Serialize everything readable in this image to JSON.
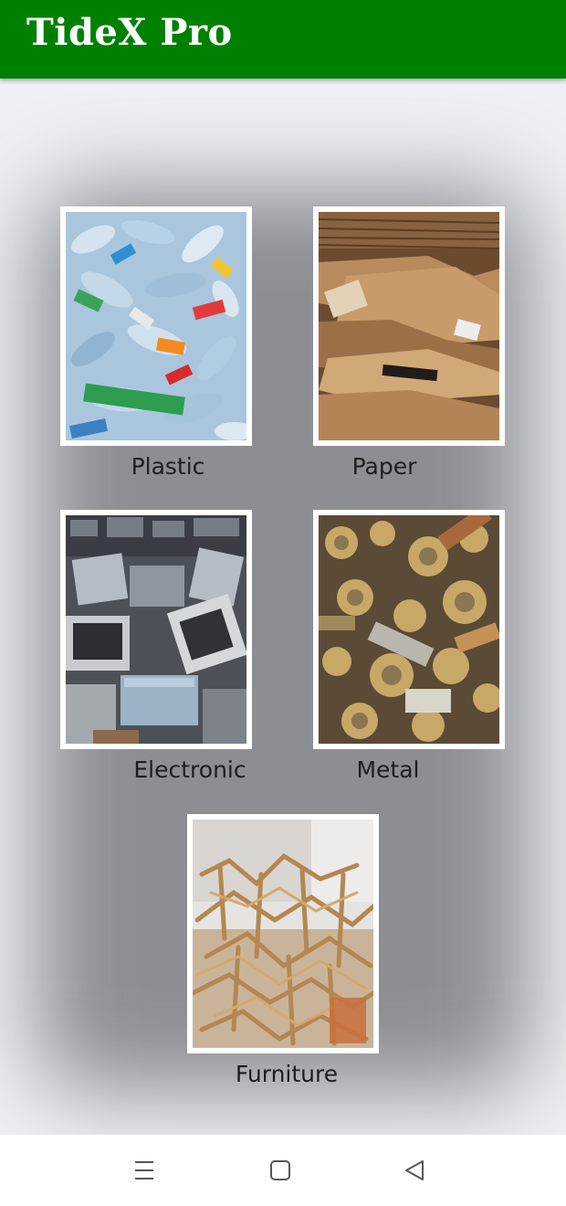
{
  "app": {
    "title": "TideX Pro",
    "colors": {
      "app_bar": "#008000",
      "background": "#eef0f5",
      "nav_bar": "#ffffff",
      "label_text": "#1e1e1e"
    }
  },
  "categories": [
    {
      "label": "Plastic",
      "image": "plastic-bottles-image"
    },
    {
      "label": "Paper",
      "image": "cardboard-paper-image"
    },
    {
      "label": "Electronic",
      "image": "electronic-waste-image"
    },
    {
      "label": "Metal",
      "image": "metal-scrap-image"
    },
    {
      "label": "Furniture",
      "image": "wooden-furniture-image"
    }
  ],
  "nav": {
    "items": [
      {
        "icon": "menu-icon"
      },
      {
        "icon": "home-square-icon"
      },
      {
        "icon": "back-triangle-icon"
      }
    ]
  }
}
